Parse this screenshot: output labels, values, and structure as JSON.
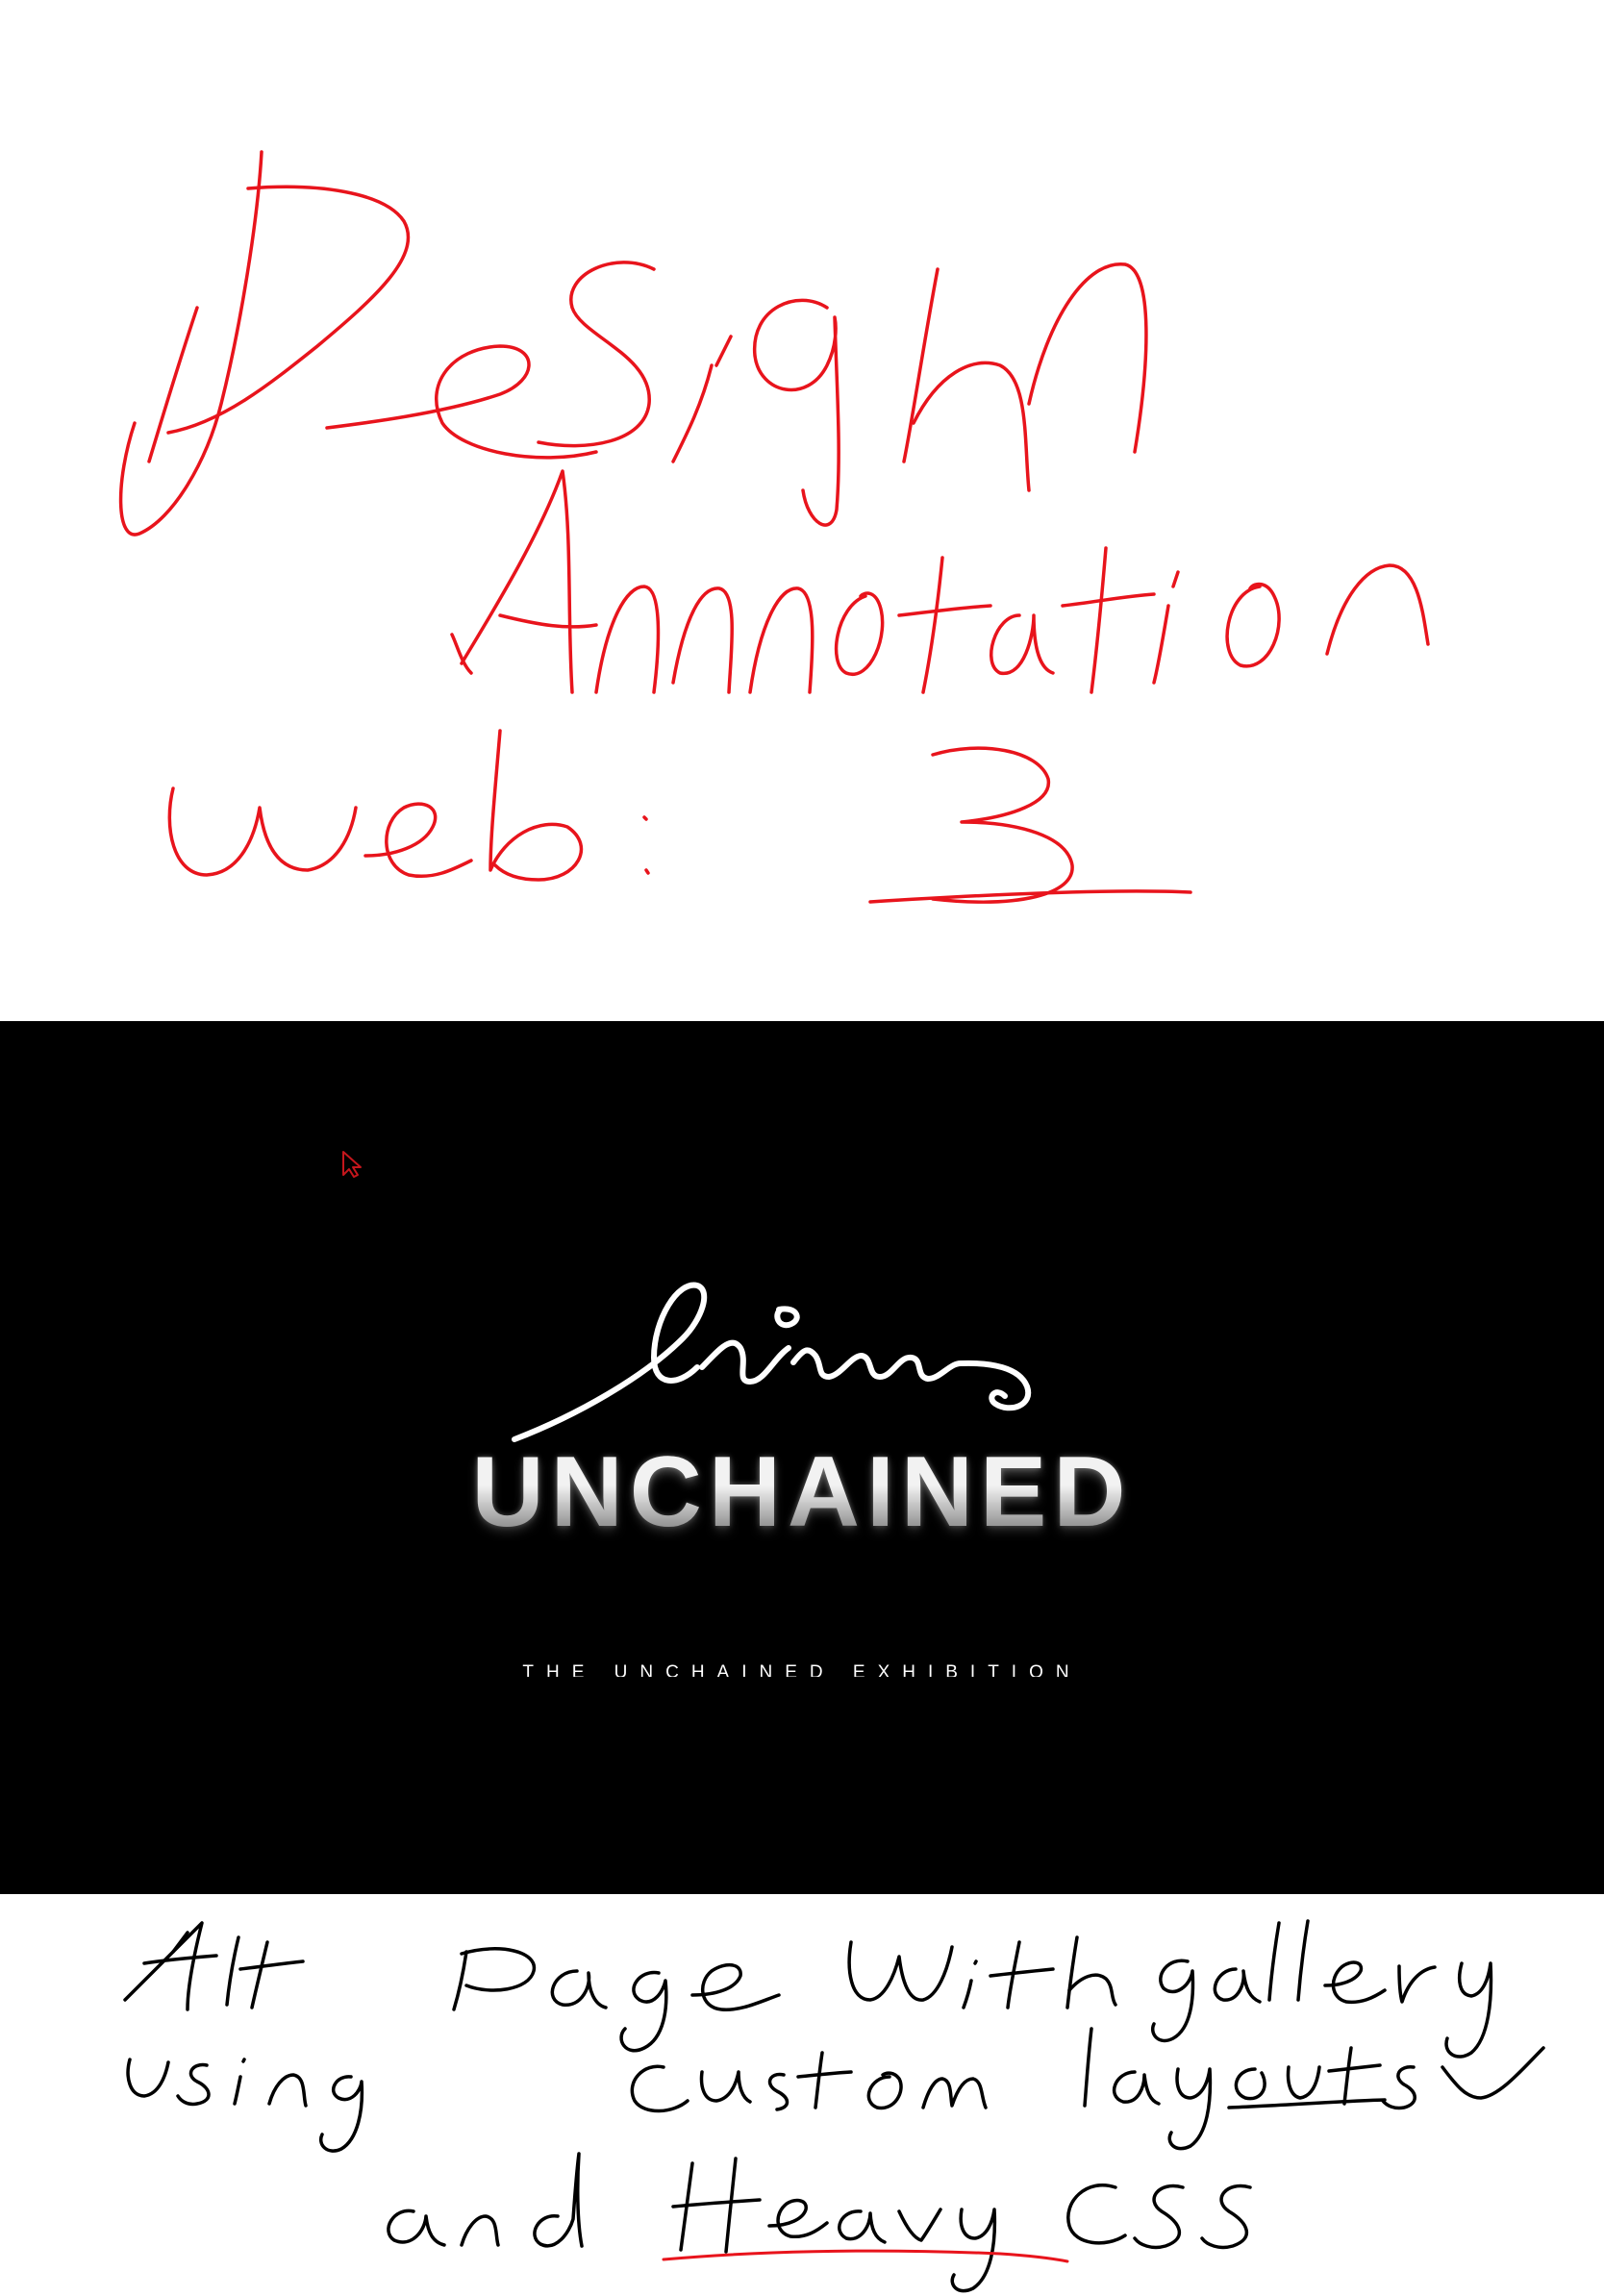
{
  "annotations": {
    "top": {
      "text": "Design Annotation web: 3",
      "color": "#e8141c"
    },
    "bottom": {
      "text": "Alt Page with gallery using custom layouts and Heavy CSS",
      "color": "#000000",
      "underline_color": "#e8141c"
    }
  },
  "hero": {
    "background": "#000000",
    "signature": "signature-logo",
    "title": "UNCHAINED",
    "subtitle": "THE UNCHAINED EXHIBITION",
    "cursor": "cursor-arrow-icon",
    "cursor_color": "#c4161c"
  }
}
